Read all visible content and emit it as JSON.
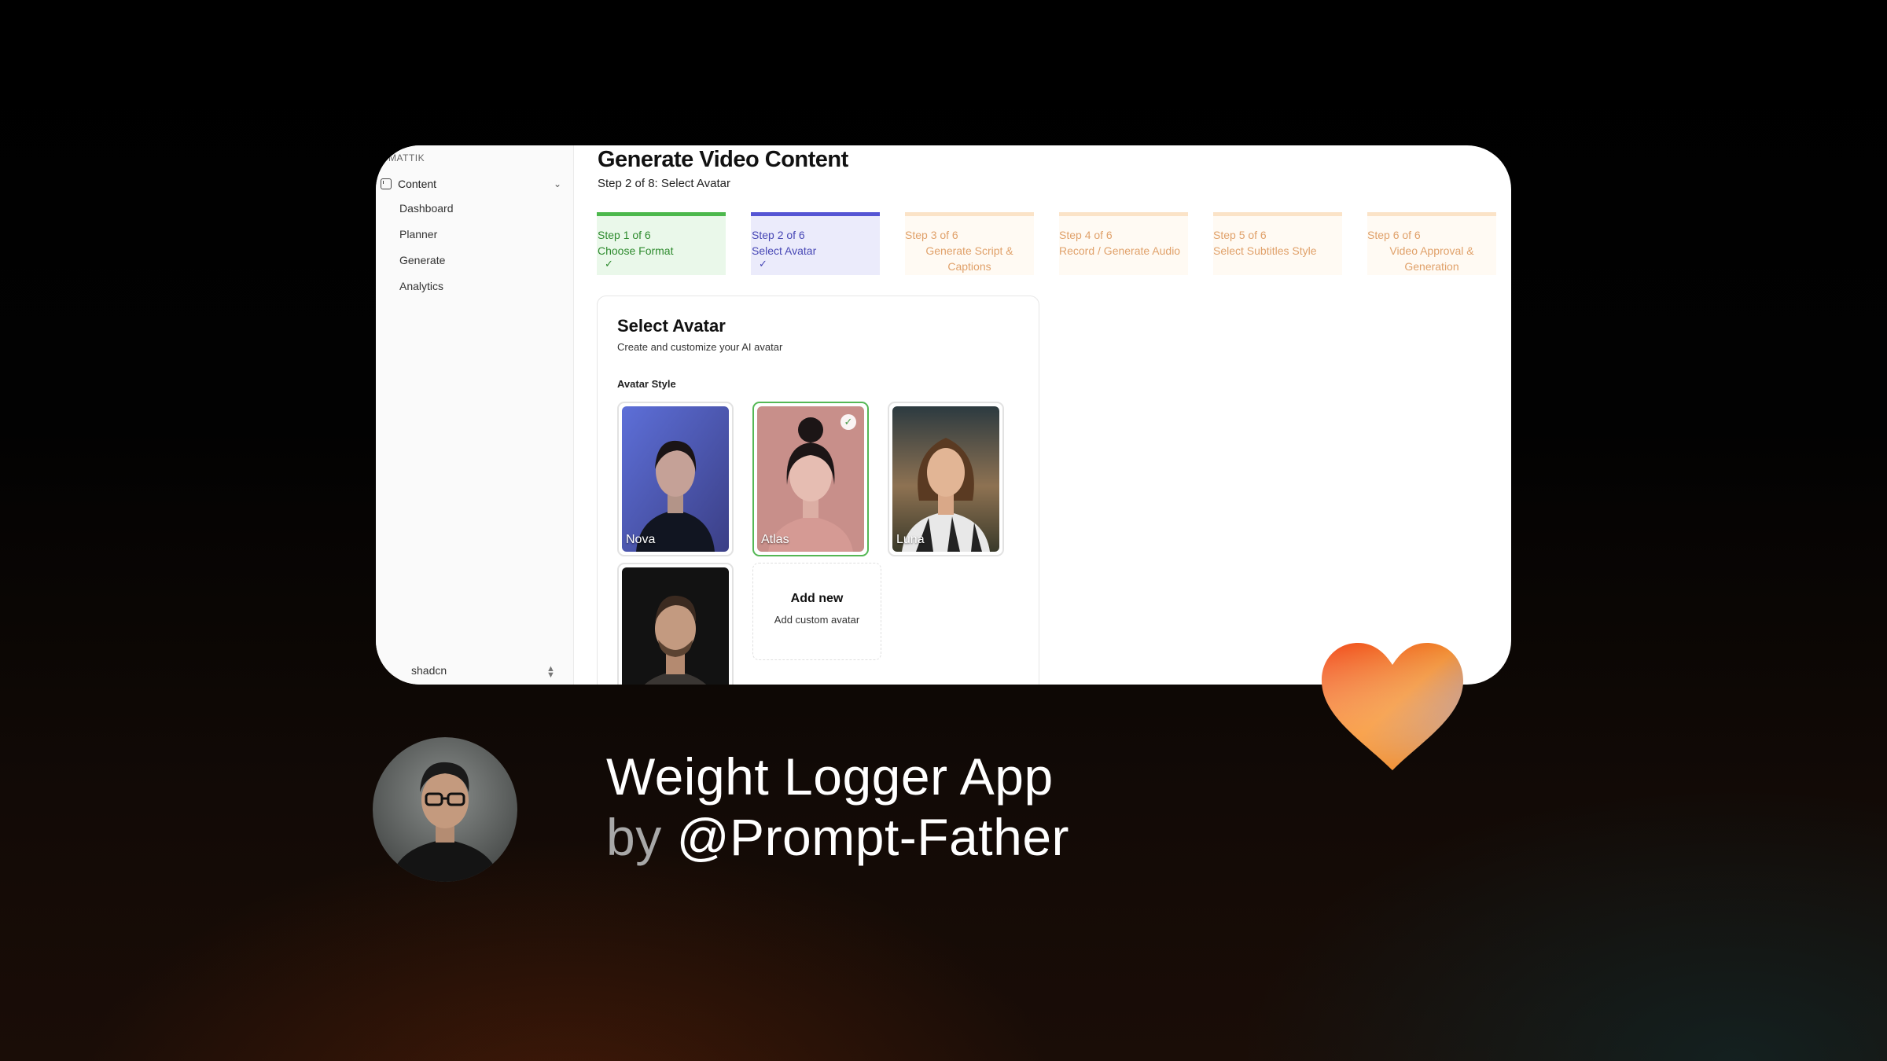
{
  "sidebar": {
    "brand": "MATTIK",
    "group_label": "Content",
    "items": [
      "Dashboard",
      "Planner",
      "Generate",
      "Analytics"
    ],
    "user": "shadcn"
  },
  "main": {
    "title": "Generate Video Content",
    "subtitle": "Step 2 of 8: Select Avatar",
    "steps": [
      {
        "step": "Step 1 of 6",
        "label": "Choose Format",
        "status": "complete"
      },
      {
        "step": "Step 2 of 6",
        "label": "Select Avatar",
        "status": "current"
      },
      {
        "step": "Step 3 of 6",
        "label": "Generate Script & Captions",
        "status": "upcoming"
      },
      {
        "step": "Step 4 of 6",
        "label": "Record / Generate Audio",
        "status": "upcoming"
      },
      {
        "step": "Step 5 of 6",
        "label": "Select Subtitles Style",
        "status": "upcoming"
      },
      {
        "step": "Step 6 of 6",
        "label": "Video Approval & Generation",
        "status": "upcoming"
      }
    ]
  },
  "panel": {
    "title": "Select Avatar",
    "subtitle": "Create and customize your AI avatar",
    "style_label": "Avatar Style",
    "avatars": [
      {
        "name": "Nova",
        "selected": false
      },
      {
        "name": "Atlas",
        "selected": true
      },
      {
        "name": "Luna",
        "selected": false
      },
      {
        "name": "",
        "selected": false
      }
    ],
    "add_new": {
      "title": "Add new",
      "subtitle": "Add custom avatar"
    }
  },
  "promo": {
    "title": "Weight Logger App",
    "by": "by",
    "author_handle": "@Prompt-Father"
  },
  "colors": {
    "step_complete": "#4cb84c",
    "step_current": "#5555d4",
    "step_upcoming": "#e0a16a",
    "selected_border": "#55b855"
  },
  "icons": [
    "content-icon",
    "chevron-down-icon",
    "chevron-updown-icon",
    "check-icon",
    "heart-icon"
  ]
}
